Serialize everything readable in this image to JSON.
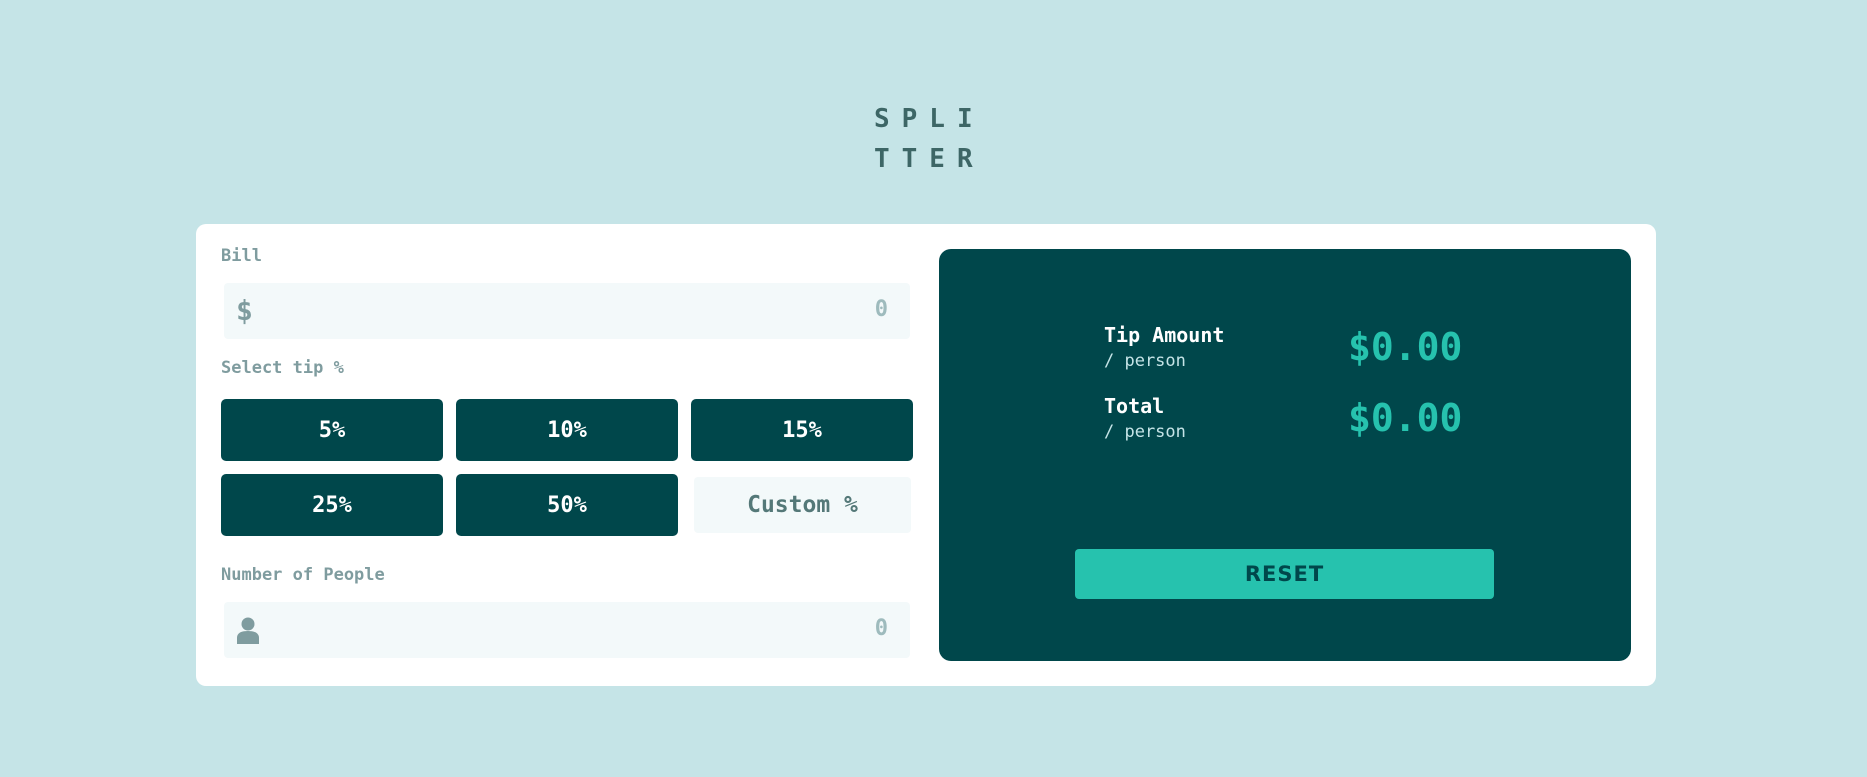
{
  "logo": {
    "line1": "SPLI",
    "line2": "TTER"
  },
  "bill": {
    "label": "Bill",
    "icon": "dollar-icon",
    "icon_glyph": "$",
    "value": "0"
  },
  "tip": {
    "label": "Select tip %",
    "options": [
      "5%",
      "10%",
      "15%",
      "25%",
      "50%"
    ],
    "custom_label": "Custom %"
  },
  "people": {
    "label": "Number of People",
    "icon": "person-icon",
    "value": "0"
  },
  "results": {
    "tip_amount": {
      "title": "Tip Amount",
      "sub": "/ person",
      "value": "$0.00"
    },
    "total": {
      "title": "Total",
      "sub": "/ person",
      "value": "$0.00"
    },
    "reset_label": "RESET"
  },
  "colors": {
    "background": "#c5e4e7",
    "dark_cyan": "#00474b",
    "strong_cyan": "#26c2ae",
    "grayish_cyan": "#7f9c9f",
    "input_bg": "#f3f9fa",
    "card": "#ffffff"
  }
}
